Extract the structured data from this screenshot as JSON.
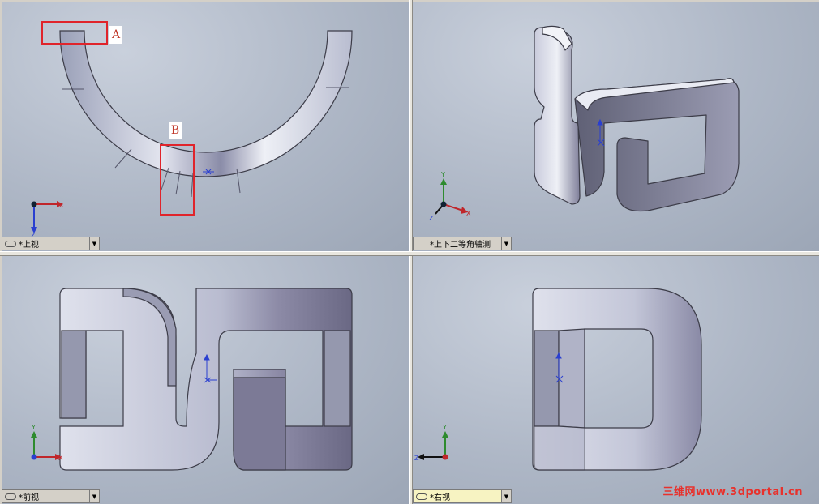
{
  "views": {
    "top": {
      "label": "*上视"
    },
    "iso": {
      "label": "*上下二等角轴测"
    },
    "front": {
      "label": "*前视"
    },
    "right": {
      "label": "*右视"
    }
  },
  "callouts": {
    "a": "A",
    "b": "B"
  },
  "axes": {
    "x": "X",
    "y": "Y",
    "z": "Z"
  },
  "watermark": "三维网www.3dportal.cn",
  "colors": {
    "viewport": "#aeb7c6",
    "callout": "#e0242b",
    "part": "#c3c6d8",
    "active_view": "#f7f3c2"
  }
}
